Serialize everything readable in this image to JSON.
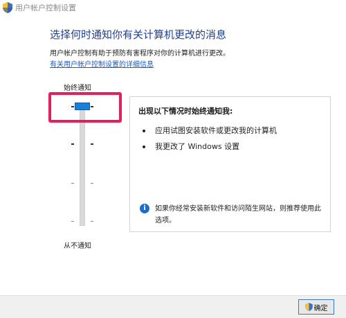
{
  "window": {
    "title": "用户帐户控制设置"
  },
  "main": {
    "heading": "选择何时通知你有关计算机更改的消息",
    "description": "用户帐户控制有助于预防有害程序对你的计算机进行更改。",
    "link": "有关用户帐户控制设置的详细信息"
  },
  "slider": {
    "top_label": "始终通知",
    "bottom_label": "从不通知",
    "levels": 4,
    "selected_level": 4
  },
  "panel": {
    "title": "出现以下情况时始终通知我:",
    "bullets": [
      "应用试图安装软件或更改我的计算机",
      "我更改了 Windows 设置"
    ],
    "info": "如果你经常安装新软件和访问陌生网站，则推荐使用此选项。"
  },
  "footer": {
    "ok_label": "确定"
  },
  "colors": {
    "heading": "#1f3f8f",
    "link": "#1e5bb8",
    "highlight": "#e4205a",
    "thumb": "#1c7fd6",
    "info": "#1c6fc9"
  },
  "icons": {
    "title": "uac-shield-icon",
    "info": "info-icon",
    "ok": "uac-shield-icon"
  }
}
